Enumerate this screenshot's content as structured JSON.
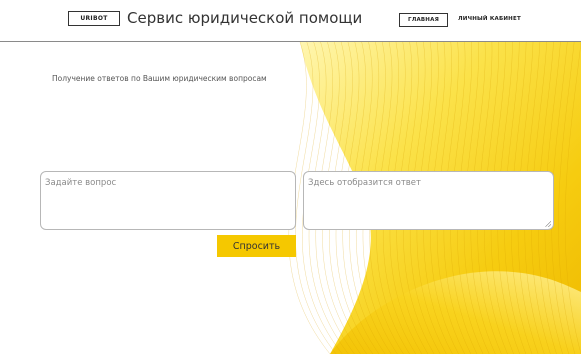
{
  "header": {
    "logo": "URIBOT",
    "title": "Сервис юридической помощи",
    "nav": {
      "home": "ГЛАВНАЯ",
      "cabinet": "ЛИЧНЫЙ КАБИНЕТ"
    }
  },
  "main": {
    "subtitle": "Получение ответов по Вашим юридическим вопросам",
    "question": {
      "placeholder": "Задайте вопрос",
      "value": ""
    },
    "answer": {
      "placeholder": "Здесь отобразится ответ"
    },
    "ask_button": "Спросить"
  },
  "colors": {
    "accent": "#f5c800",
    "wave_light": "#fbe45a",
    "wave_dark": "#e9b400",
    "border": "#b7b7b7"
  },
  "icons": {
    "background": "yellow-wave-pattern",
    "textarea_resize": "resize-grip-icon"
  }
}
